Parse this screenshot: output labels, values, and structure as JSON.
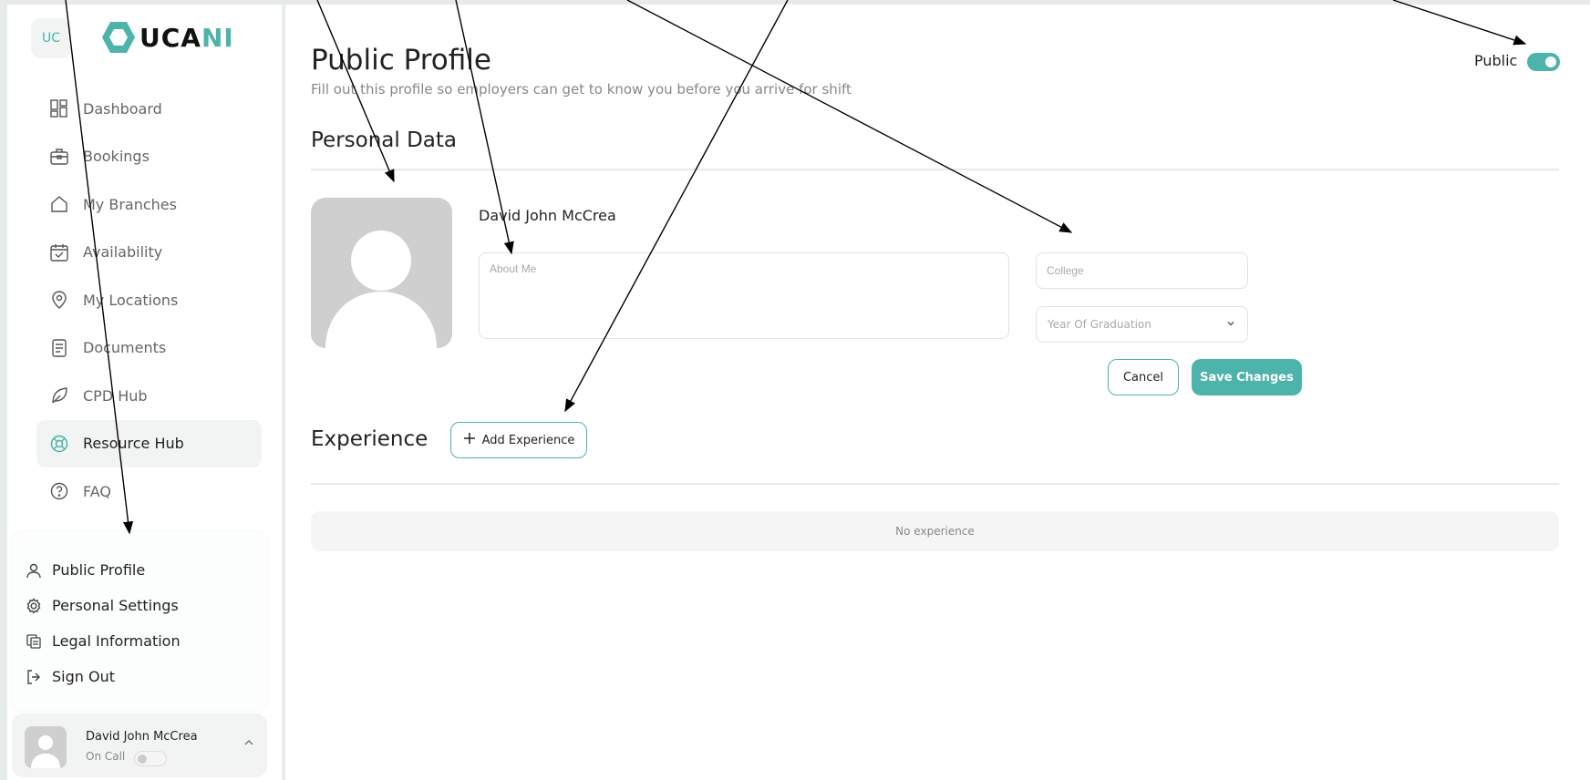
{
  "brand": {
    "badge": "UC",
    "word_main": "UCA",
    "word_accent": "NI",
    "accent_color": "#4db3ab"
  },
  "sidebar": {
    "items": [
      {
        "label": "Dashboard",
        "icon": "dashboard-icon"
      },
      {
        "label": "Bookings",
        "icon": "briefcase-icon"
      },
      {
        "label": "My Branches",
        "icon": "home-icon"
      },
      {
        "label": "Availability",
        "icon": "calendar-check-icon"
      },
      {
        "label": "My Locations",
        "icon": "location-pin-icon"
      },
      {
        "label": "Documents",
        "icon": "document-icon"
      },
      {
        "label": "CPD Hub",
        "icon": "leaf-icon"
      },
      {
        "label": "Resource Hub",
        "icon": "lifebuoy-icon",
        "active": true
      },
      {
        "label": "FAQ",
        "icon": "question-circle-icon"
      }
    ]
  },
  "account_menu": {
    "items": [
      {
        "label": "Public Profile",
        "icon": "user-icon"
      },
      {
        "label": "Personal Settings",
        "icon": "gear-icon"
      },
      {
        "label": "Legal Information",
        "icon": "copy-docs-icon"
      },
      {
        "label": "Sign Out",
        "icon": "sign-out-icon"
      }
    ]
  },
  "user": {
    "name": "David John McCrea",
    "status_label": "On Call",
    "on_call": false
  },
  "page": {
    "title": "Public Profile",
    "subtitle": "Fill out this profile so employers can get to know you before you arrive for shift",
    "public_label": "Public",
    "public_on": true
  },
  "personal": {
    "section_title": "Personal Data",
    "name": "David John McCrea",
    "about_placeholder": "About Me",
    "college_placeholder": "College",
    "graduation_placeholder": "Year Of Graduation",
    "cancel_label": "Cancel",
    "save_label": "Save Changes"
  },
  "experience": {
    "section_title": "Experience",
    "add_label": "Add Experience",
    "empty_text": "No experience"
  }
}
